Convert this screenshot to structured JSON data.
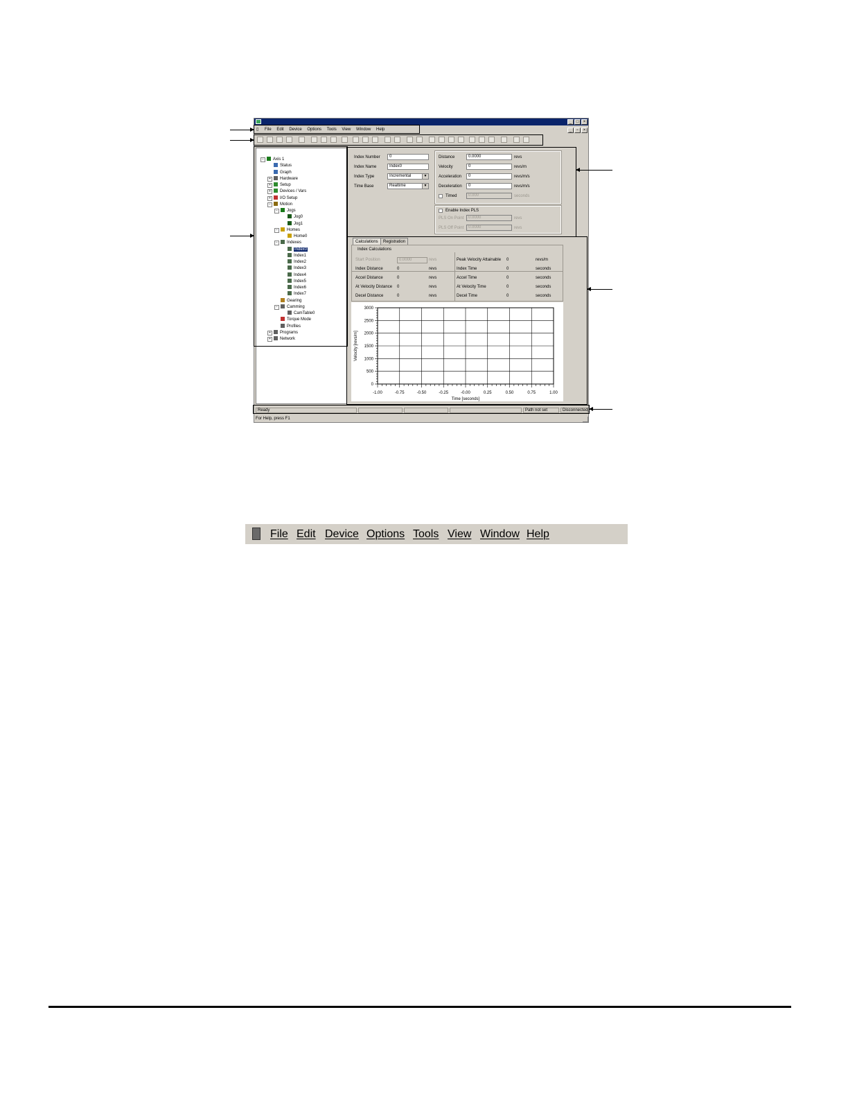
{
  "menu": {
    "items": [
      "File",
      "Edit",
      "Device",
      "Options",
      "Tools",
      "View",
      "Window",
      "Help"
    ]
  },
  "tree": {
    "nodes": [
      {
        "label": "Axis 1",
        "icon": "drive-icon",
        "color": "#1a7a1a"
      },
      {
        "label": "Status",
        "icon": "status-icon",
        "color": "#3a6ab0"
      },
      {
        "label": "Graph",
        "icon": "graph-icon",
        "color": "#3a6ab0"
      },
      {
        "label": "Hardware",
        "icon": "hardware-icon",
        "color": "#606060"
      },
      {
        "label": "Setup",
        "icon": "setup-icon",
        "color": "#2e8b2e"
      },
      {
        "label": "Devices / Vars",
        "icon": "devices-icon",
        "color": "#2e8b2e"
      },
      {
        "label": "I/O Setup",
        "icon": "io-setup-icon",
        "color": "#c03030"
      },
      {
        "label": "Motion",
        "icon": "motion-icon",
        "color": "#8a6a10"
      },
      {
        "label": "Jogs",
        "icon": "jogs-icon",
        "color": "#1a7a1a"
      },
      {
        "label": "Jog0",
        "icon": "jog-arrow-icon",
        "color": "#1a5a1a"
      },
      {
        "label": "Jog1",
        "icon": "jog-arrow-icon",
        "color": "#1a5a1a"
      },
      {
        "label": "Homes",
        "icon": "homes-icon",
        "color": "#c8a000"
      },
      {
        "label": "Home0",
        "icon": "home-icon",
        "color": "#c8a000"
      },
      {
        "label": "Indexes",
        "icon": "indexes-icon",
        "color": "#4a6a4a"
      },
      {
        "label": "Index0",
        "icon": "index-icon",
        "color": "#4a6a4a"
      },
      {
        "label": "Index1",
        "icon": "index-icon",
        "color": "#4a6a4a"
      },
      {
        "label": "Index2",
        "icon": "index-icon",
        "color": "#4a6a4a"
      },
      {
        "label": "Index3",
        "icon": "index-icon",
        "color": "#4a6a4a"
      },
      {
        "label": "Index4",
        "icon": "index-icon",
        "color": "#4a6a4a"
      },
      {
        "label": "Index5",
        "icon": "index-icon",
        "color": "#4a6a4a"
      },
      {
        "label": "Index6",
        "icon": "index-icon",
        "color": "#4a6a4a"
      },
      {
        "label": "Index7",
        "icon": "index-icon",
        "color": "#4a6a4a"
      },
      {
        "label": "Gearing",
        "icon": "gearing-icon",
        "color": "#b08020"
      },
      {
        "label": "Camming",
        "icon": "camming-icon",
        "color": "#606060"
      },
      {
        "label": "CamTable0",
        "icon": "cam-table-icon",
        "color": "#606060"
      },
      {
        "label": "Torque Mode",
        "icon": "torque-icon",
        "color": "#c03030"
      },
      {
        "label": "Profiles",
        "icon": "profiles-icon",
        "color": "#606060"
      },
      {
        "label": "Programs",
        "icon": "programs-icon",
        "color": "#606060"
      },
      {
        "label": "Network",
        "icon": "network-icon",
        "color": "#606060"
      }
    ]
  },
  "index_props": {
    "index_number_label": "Index Number",
    "index_number": "0",
    "index_name_label": "Index Name",
    "index_name": "Index0",
    "index_type_label": "Index Type",
    "index_type": "Incremental",
    "time_base_label": "Time Base",
    "time_base": "Realtime",
    "distance_label": "Distance",
    "distance": "0.0000",
    "distance_unit": "revs",
    "velocity_label": "Velocity",
    "velocity": "0",
    "velocity_unit": "revs/m",
    "acceleration_label": "Acceleration",
    "acceleration": "0",
    "acceleration_unit": "revs/m/s",
    "deceleration_label": "Deceleration",
    "deceleration": "0",
    "deceleration_unit": "revs/m/s",
    "timed_label": "Timed",
    "timed_value": "0.000",
    "timed_unit": "seconds",
    "enable_pls_label": "Enable Index PLS",
    "pls_on_label": "PLS On Point",
    "pls_on_value": "0.0000",
    "pls_on_unit": "revs",
    "pls_off_label": "PLS Off Point",
    "pls_off_value": "0.0000",
    "pls_off_unit": "revs"
  },
  "calc": {
    "tabs": [
      "Calculations",
      "Registration"
    ],
    "group_title": "Index Calculations",
    "start_position_label": "Start Position",
    "start_position": "0.0000",
    "start_position_unit": "revs",
    "peak_velocity_label": "Peak Velocity Attainable",
    "peak_velocity": "0",
    "peak_velocity_unit": "revs/m",
    "index_distance_label": "Index Distance",
    "index_distance": "0",
    "index_distance_unit": "revs",
    "index_time_label": "Index Time",
    "index_time": "0",
    "index_time_unit": "seconds",
    "accel_distance_label": "Accel Distance",
    "accel_distance": "0",
    "accel_distance_unit": "revs",
    "accel_time_label": "Accel Time",
    "accel_time": "0",
    "accel_time_unit": "seconds",
    "at_vel_distance_label": "At Velocity Distance",
    "at_vel_distance": "0",
    "at_vel_distance_unit": "revs",
    "at_vel_time_label": "At Velocity Time",
    "at_vel_time": "0",
    "at_vel_time_unit": "seconds",
    "decel_distance_label": "Decel Distance",
    "decel_distance": "0",
    "decel_distance_unit": "revs",
    "decel_time_label": "Decel Time",
    "decel_time": "0",
    "decel_time_unit": "seconds"
  },
  "chart_data": {
    "type": "line",
    "xlabel": "Time [seconds]",
    "ylabel": "Velocity [revs/m]",
    "xlim": [
      -1.0,
      1.0
    ],
    "ylim": [
      0,
      3000
    ],
    "x_ticks": [
      "-1.00",
      "-0.75",
      "-0.50",
      "-0.25",
      "-0.00",
      "0.25",
      "0.50",
      "0.75",
      "1.00"
    ],
    "y_ticks": [
      "0",
      "500",
      "1000",
      "1500",
      "2000",
      "2500",
      "3000"
    ],
    "grid": true,
    "series": []
  },
  "status": {
    "ready": "Ready",
    "path": "Path not set",
    "connection": "Disconnected",
    "help": "For Help, press F1"
  },
  "colors": {
    "title_bar": "#0a246a",
    "window_face": "#d4d0c8",
    "selection": "#0a246a"
  }
}
